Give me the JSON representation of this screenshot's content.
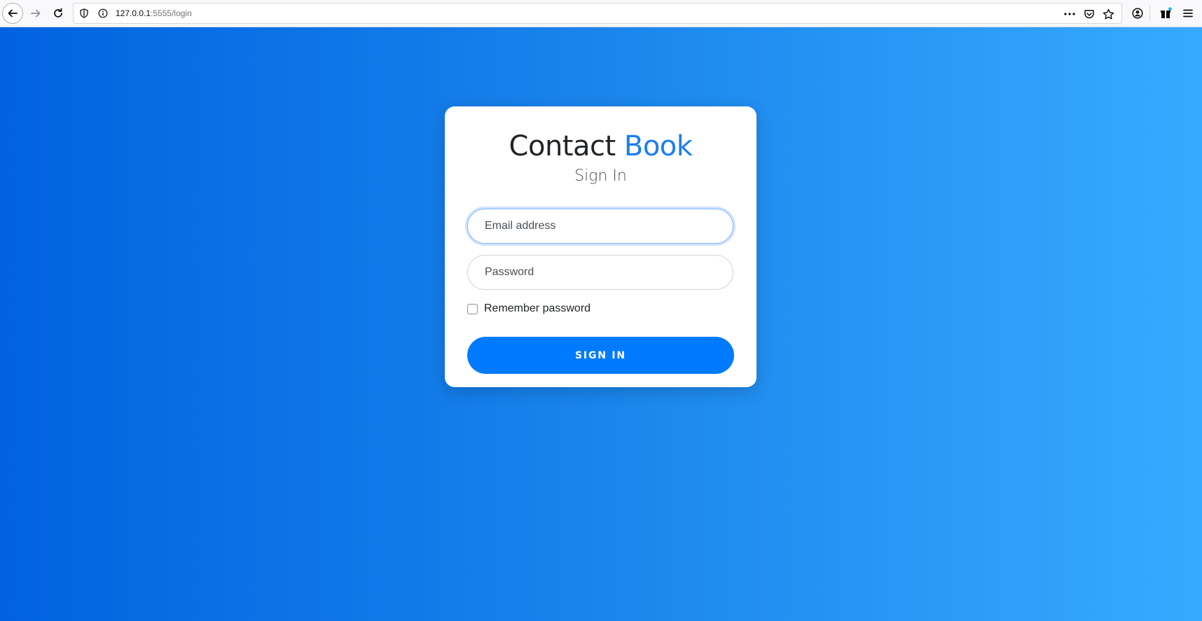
{
  "browser": {
    "url_host": "127.0.0.1",
    "url_path": ":5555/login",
    "icons": [
      "back-arrow-icon",
      "forward-arrow-icon",
      "reload-icon",
      "shield-icon",
      "info-icon",
      "more-icon",
      "pocket-icon",
      "star-icon",
      "account-icon",
      "gift-icon",
      "menu-icon"
    ]
  },
  "login": {
    "title_main": "Contact",
    "title_accent": "Book",
    "subtitle": "Sign In",
    "email_placeholder": "Email address",
    "password_placeholder": "Password",
    "remember_label": "Remember password",
    "signin_label": "SIGN IN"
  },
  "colors": {
    "accent": "#1a7ff0",
    "button": "#007bff",
    "gradient_start": "#0062e0",
    "gradient_end": "#36aaff"
  }
}
